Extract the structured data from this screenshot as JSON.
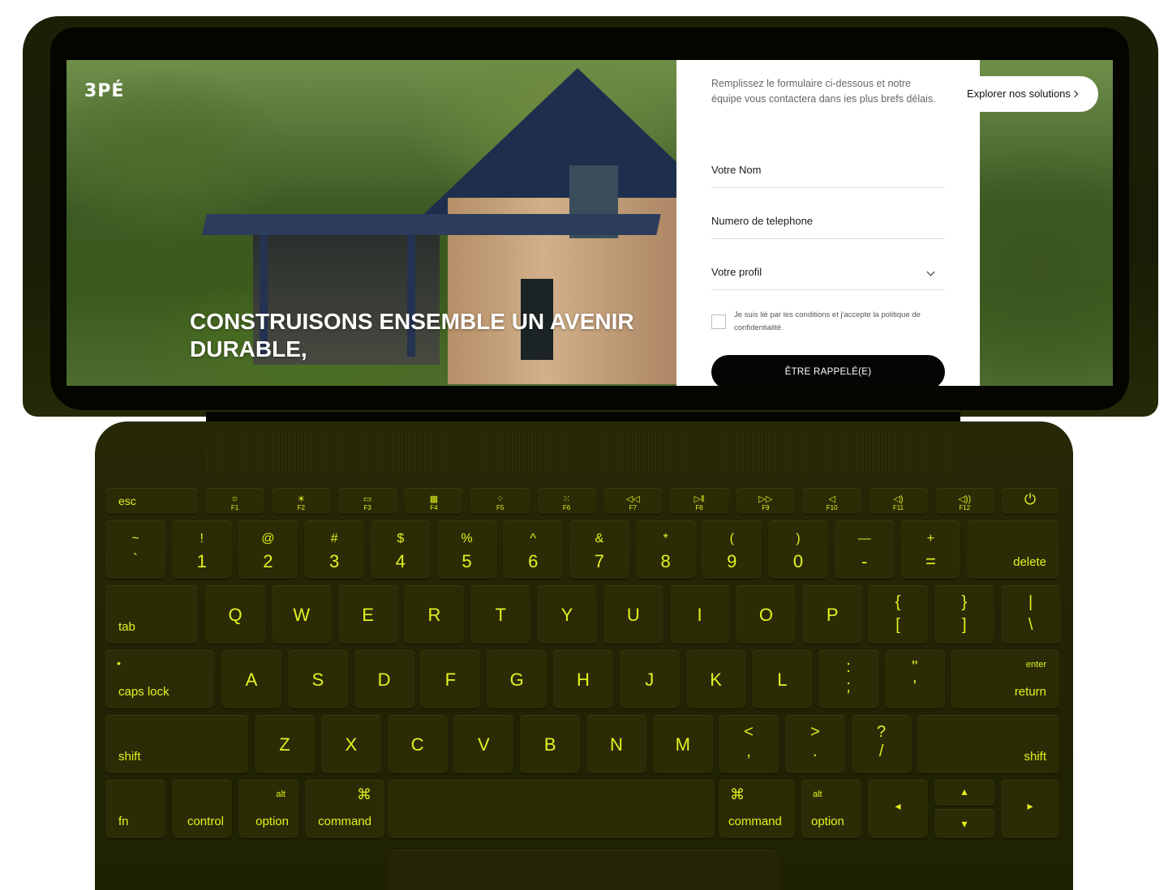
{
  "site": {
    "logo": "3PÉ",
    "hero_title": "CONSTRUISONS ENSEMBLE UN AVENIR DURABLE,",
    "explore_button": "Explorer nos solutions",
    "form": {
      "intro": "Remplissez le formulaire ci-dessous et notre équipe vous contactera dans ies plus brefs délais.",
      "name_placeholder": "Votre Nom",
      "phone_placeholder": "Numero de telephone",
      "profile_placeholder": "Votre profil",
      "consent": "Je suis lié par les conditions et j'accepte la politique de confidentialité.",
      "submit": "ÊTRE RAPPELÉ(E)"
    }
  },
  "keyboard": {
    "fn_row": {
      "esc": "esc",
      "f_labels": [
        "F1",
        "F2",
        "F3",
        "F4",
        "F5",
        "F6",
        "F7",
        "F8",
        "F9",
        "F10",
        "F11",
        "F12"
      ],
      "f_icons": [
        "☼",
        "☀",
        "▭",
        "▦",
        "⁘",
        "⁙",
        "◁◁",
        "▷‖",
        "▷▷",
        "◁",
        "◁)",
        "◁))"
      ],
      "power_icon": "⏻"
    },
    "number_row": [
      {
        "top": "~",
        "bottom": "`"
      },
      {
        "top": "!",
        "bottom": "1"
      },
      {
        "top": "@",
        "bottom": "2"
      },
      {
        "top": "#",
        "bottom": "3"
      },
      {
        "top": "$",
        "bottom": "4"
      },
      {
        "top": "%",
        "bottom": "5"
      },
      {
        "top": "^",
        "bottom": "6"
      },
      {
        "top": "&",
        "bottom": "7"
      },
      {
        "top": "*",
        "bottom": "8"
      },
      {
        "top": "(",
        "bottom": "9"
      },
      {
        "top": ")",
        "bottom": "0"
      },
      {
        "top": "—",
        "bottom": "-"
      },
      {
        "top": "+",
        "bottom": "="
      }
    ],
    "delete": "delete",
    "tab": "tab",
    "qwerty_row": [
      "Q",
      "W",
      "E",
      "R",
      "T",
      "Y",
      "U",
      "I",
      "O",
      "P"
    ],
    "qwerty_symbols": [
      {
        "top": "{",
        "bottom": "["
      },
      {
        "top": "}",
        "bottom": "]"
      },
      {
        "top": "|",
        "bottom": "\\"
      }
    ],
    "caps_lock": "caps lock",
    "caps_indicator": "•",
    "home_row": [
      "A",
      "S",
      "D",
      "F",
      "G",
      "H",
      "J",
      "K",
      "L"
    ],
    "home_symbols": [
      {
        "top": ":",
        "bottom": ";"
      },
      {
        "top": "\"",
        "bottom": "'"
      }
    ],
    "enter": "enter",
    "return": "return",
    "shift_left": "shift",
    "bottom_row": [
      "Z",
      "X",
      "C",
      "V",
      "B",
      "N",
      "M"
    ],
    "bottom_symbols": [
      {
        "top": "<",
        "bottom": ","
      },
      {
        "top": ">",
        "bottom": "."
      },
      {
        "top": "?",
        "bottom": "/"
      }
    ],
    "shift_right": "shift",
    "fn": "fn",
    "control": "control",
    "alt": "alt",
    "option": "option",
    "command_symbol": "⌘",
    "command": "command",
    "arrow_left": "◂",
    "arrow_up": "▴",
    "arrow_down": "▾",
    "arrow_right": "▸"
  },
  "colors": {
    "key_legend": "#e4f21f",
    "key_cap": "#2b2c06",
    "chassis": "#232505"
  }
}
